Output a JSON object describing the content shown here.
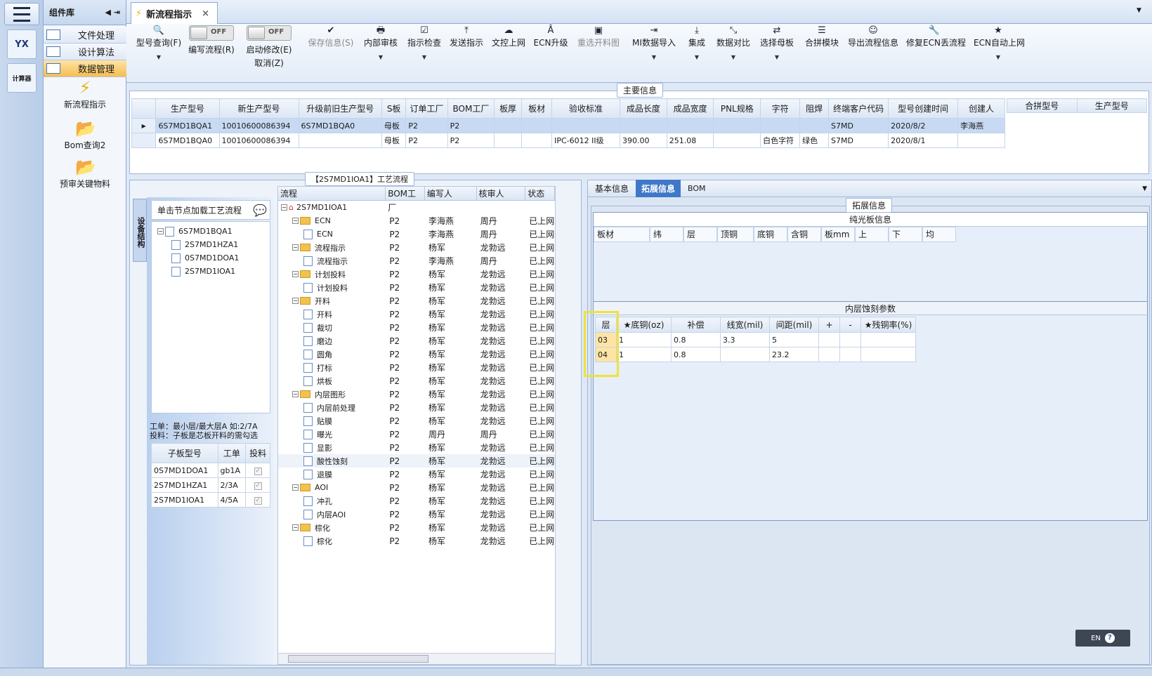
{
  "rail": {
    "logo": "YX",
    "icon2": "计算器"
  },
  "library": {
    "title": "组件库",
    "nav": [
      {
        "label": "文件处理"
      },
      {
        "label": "设计算法"
      },
      {
        "label": "数据管理"
      }
    ],
    "items": [
      {
        "label": "新流程指示",
        "icon": "lightning-icon"
      },
      {
        "label": "Bom查询2",
        "icon": "folder-icon"
      },
      {
        "label": "预审关键物料",
        "icon": "folder-icon"
      }
    ]
  },
  "tab": {
    "label": "新流程指示",
    "close": "×"
  },
  "toolbar": {
    "query": "型号查询(F)",
    "edit_flow": "编写流程(R)",
    "edit_toggle": "OFF",
    "auto_modify": "启动修改(E)",
    "auto_toggle": "OFF",
    "cancel": "取消(Z)",
    "save": "保存信息(S)",
    "internal_review": "内部审核",
    "check": "指示检查",
    "send": "发送指示",
    "upload": "文控上网",
    "ecn_upgrade": "ECN升级",
    "reselect": "重选开料图",
    "mi_import": "MI数据导入",
    "integrate": "集成",
    "compare": "数据对比",
    "select_mother": "选择母板",
    "merge": "合拼模块",
    "export": "导出流程信息",
    "fix_ecn": "修复ECN丢流程",
    "ecn_auto": "ECN自动上网"
  },
  "main_info": {
    "title": "主要信息",
    "columns": [
      "生产型号",
      "新生产型号",
      "升级前旧生产型号",
      "S板",
      "订单工厂",
      "BOM工厂",
      "板厚",
      "板材",
      "验收标准",
      "成品长度",
      "成品宽度",
      "PNL规格",
      "字符",
      "阻焊",
      "终端客户代码",
      "型号创建时间",
      "创建人"
    ],
    "rows": [
      [
        "6S7MD1BQA1",
        "10010600086394",
        "6S7MD1BQA0",
        "母板",
        "P2",
        "P2",
        "",
        "",
        "",
        "",
        "",
        "",
        "",
        "",
        "S7MD",
        "2020/8/2",
        "李海燕"
      ],
      [
        "6S7MD1BQA0",
        "10010600086394",
        "",
        "母板",
        "P2",
        "P2",
        "",
        "",
        "IPC-6012 II级",
        "390.00",
        "251.08",
        "",
        "白色字符",
        "绿色",
        "S7MD",
        "2020/8/1",
        ""
      ]
    ],
    "merge_cols": [
      "合拼型号",
      "生产型号"
    ]
  },
  "process": {
    "title": "【2S7MD1IOA1】工艺流程",
    "side_tab": "设备结构",
    "load_hint": "单击节点加载工艺流程",
    "tree_nodes": [
      "6S7MD1BQA1",
      "2S7MD1HZA1",
      "0S7MD1DOA1",
      "2S7MD1IOA1"
    ],
    "note1": "工单：最小层/最大层A 如:2/7A",
    "note2": "投料：子板是芯板开料的需勾选",
    "sub_cols": [
      "子板型号",
      "工单",
      "投料"
    ],
    "sub_rows": [
      [
        "0S7MD1DOA1",
        "gb1A"
      ],
      [
        "2S7MD1HZA1",
        "2/3A"
      ],
      [
        "2S7MD1IOA1",
        "4/5A"
      ]
    ],
    "flow_cols": [
      "流程",
      "BOM工厂",
      "编写人",
      "核审人",
      "状态"
    ],
    "flow_rows": [
      {
        "name": "2S7MD1IOA1",
        "lvl": 0,
        "type": "root",
        "f": "",
        "w": "",
        "r": "",
        "s": ""
      },
      {
        "name": "ECN",
        "lvl": 1,
        "type": "folder",
        "f": "P2",
        "w": "李海燕",
        "r": "周丹",
        "s": "已上网"
      },
      {
        "name": "ECN",
        "lvl": 2,
        "type": "file",
        "f": "P2",
        "w": "李海燕",
        "r": "周丹",
        "s": "已上网"
      },
      {
        "name": "流程指示",
        "lvl": 1,
        "type": "folder",
        "f": "P2",
        "w": "杨军",
        "r": "龙勃远",
        "s": "已上网"
      },
      {
        "name": "流程指示",
        "lvl": 2,
        "type": "file",
        "f": "P2",
        "w": "李海燕",
        "r": "周丹",
        "s": "已上网"
      },
      {
        "name": "计划投料",
        "lvl": 1,
        "type": "folder",
        "f": "P2",
        "w": "杨军",
        "r": "龙勃远",
        "s": "已上网"
      },
      {
        "name": "计划投料",
        "lvl": 2,
        "type": "file",
        "f": "P2",
        "w": "杨军",
        "r": "龙勃远",
        "s": "已上网"
      },
      {
        "name": "开料",
        "lvl": 1,
        "type": "folder",
        "f": "P2",
        "w": "杨军",
        "r": "龙勃远",
        "s": "已上网"
      },
      {
        "name": "开料",
        "lvl": 2,
        "type": "file",
        "f": "P2",
        "w": "杨军",
        "r": "龙勃远",
        "s": "已上网"
      },
      {
        "name": "裁切",
        "lvl": 2,
        "type": "file",
        "f": "P2",
        "w": "杨军",
        "r": "龙勃远",
        "s": "已上网"
      },
      {
        "name": "磨边",
        "lvl": 2,
        "type": "file",
        "f": "P2",
        "w": "杨军",
        "r": "龙勃远",
        "s": "已上网"
      },
      {
        "name": "圆角",
        "lvl": 2,
        "type": "file",
        "f": "P2",
        "w": "杨军",
        "r": "龙勃远",
        "s": "已上网"
      },
      {
        "name": "打标",
        "lvl": 2,
        "type": "file",
        "f": "P2",
        "w": "杨军",
        "r": "龙勃远",
        "s": "已上网"
      },
      {
        "name": "烘板",
        "lvl": 2,
        "type": "file",
        "f": "P2",
        "w": "杨军",
        "r": "龙勃远",
        "s": "已上网"
      },
      {
        "name": "内层图形",
        "lvl": 1,
        "type": "folder",
        "f": "P2",
        "w": "杨军",
        "r": "龙勃远",
        "s": "已上网"
      },
      {
        "name": "内层前处理",
        "lvl": 2,
        "type": "file",
        "f": "P2",
        "w": "杨军",
        "r": "龙勃远",
        "s": "已上网"
      },
      {
        "name": "贴膜",
        "lvl": 2,
        "type": "file",
        "f": "P2",
        "w": "杨军",
        "r": "龙勃远",
        "s": "已上网"
      },
      {
        "name": "曝光",
        "lvl": 2,
        "type": "file",
        "f": "P2",
        "w": "周丹",
        "r": "周丹",
        "s": "已上网"
      },
      {
        "name": "显影",
        "lvl": 2,
        "type": "file",
        "f": "P2",
        "w": "杨军",
        "r": "龙勃远",
        "s": "已上网"
      },
      {
        "name": "酸性蚀刻",
        "lvl": 2,
        "type": "file",
        "f": "P2",
        "w": "杨军",
        "r": "龙勃远",
        "s": "已上网"
      },
      {
        "name": "退膜",
        "lvl": 2,
        "type": "file",
        "f": "P2",
        "w": "杨军",
        "r": "龙勃远",
        "s": "已上网"
      },
      {
        "name": "AOI",
        "lvl": 1,
        "type": "folder",
        "f": "P2",
        "w": "杨军",
        "r": "龙勃远",
        "s": "已上网"
      },
      {
        "name": "冲孔",
        "lvl": 2,
        "type": "file",
        "f": "P2",
        "w": "杨军",
        "r": "龙勃远",
        "s": "已上网"
      },
      {
        "name": "内层AOI",
        "lvl": 2,
        "type": "file",
        "f": "P2",
        "w": "杨军",
        "r": "龙勃远",
        "s": "已上网"
      },
      {
        "name": "棕化",
        "lvl": 1,
        "type": "folder",
        "f": "P2",
        "w": "杨军",
        "r": "龙勃远",
        "s": "已上网"
      },
      {
        "name": "棕化",
        "lvl": 2,
        "type": "file",
        "f": "P2",
        "w": "杨军",
        "r": "龙勃远",
        "s": "已上网"
      }
    ]
  },
  "detail": {
    "tabs": [
      "基本信息",
      "拓展信息",
      "BOM"
    ],
    "title": "拓展信息",
    "plain_title": "纯光板信息",
    "plain_cols": [
      "板材",
      "纬",
      "层",
      "顶铜",
      "底铜",
      "含铜",
      "板mm",
      "上",
      "下",
      "均"
    ],
    "etch_title": "内层蚀刻参数",
    "etch_cols": [
      "层",
      "★底铜(oz)",
      "补偿",
      "线宽(mil)",
      "间距(mil)",
      "+",
      "-",
      "★残铜率(%)"
    ],
    "etch_rows": [
      [
        "03",
        "1",
        "0.8",
        "3.3",
        "5",
        "",
        "",
        ""
      ],
      [
        "04",
        "1",
        "0.8",
        "",
        "23.2",
        "",
        "",
        ""
      ]
    ],
    "lang": "EN",
    "help": "?"
  }
}
